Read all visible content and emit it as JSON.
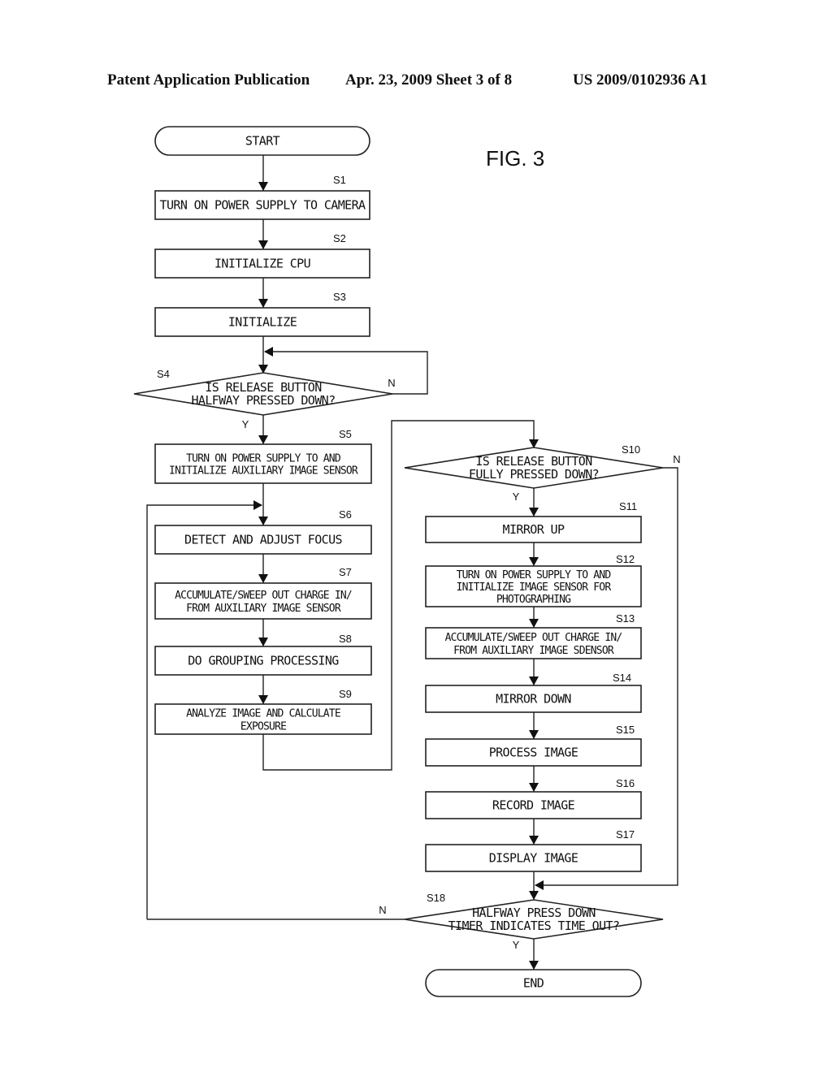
{
  "header": {
    "publication": "Patent Application Publication",
    "date_sheet": "Apr. 23, 2009  Sheet 3 of 8",
    "number": "US 2009/0102936 A1"
  },
  "figure": {
    "title": "FIG. 3"
  },
  "flowchart": {
    "start": "START",
    "end": "END",
    "steps": {
      "s1": {
        "id": "S1",
        "lines": [
          "TURN ON POWER SUPPLY TO CAMERA"
        ]
      },
      "s2": {
        "id": "S2",
        "lines": [
          "INITIALIZE CPU"
        ]
      },
      "s3": {
        "id": "S3",
        "lines": [
          "INITIALIZE"
        ]
      },
      "s4": {
        "id": "S4",
        "lines": [
          "IS RELEASE BUTTON",
          "HALFWAY PRESSED DOWN?"
        ],
        "yes": "Y",
        "no": "N"
      },
      "s5": {
        "id": "S5",
        "lines": [
          "TURN ON POWER SUPPLY TO AND",
          "INITIALIZE AUXILIARY IMAGE SENSOR"
        ]
      },
      "s6": {
        "id": "S6",
        "lines": [
          "DETECT AND ADJUST FOCUS"
        ]
      },
      "s7": {
        "id": "S7",
        "lines": [
          "ACCUMULATE/SWEEP OUT CHARGE IN/",
          "FROM AUXILIARY IMAGE SENSOR"
        ]
      },
      "s8": {
        "id": "S8",
        "lines": [
          "DO GROUPING PROCESSING"
        ]
      },
      "s9": {
        "id": "S9",
        "lines": [
          "ANALYZE IMAGE AND CALCULATE",
          "EXPOSURE"
        ]
      },
      "s10": {
        "id": "S10",
        "lines": [
          "IS RELEASE BUTTON",
          "FULLY PRESSED DOWN?"
        ],
        "yes": "Y",
        "no": "N"
      },
      "s11": {
        "id": "S11",
        "lines": [
          "MIRROR UP"
        ]
      },
      "s12": {
        "id": "S12",
        "lines": [
          "TURN ON POWER SUPPLY TO AND",
          "INITIALIZE IMAGE SENSOR FOR",
          "PHOTOGRAPHING"
        ]
      },
      "s13": {
        "id": "S13",
        "lines": [
          "ACCUMULATE/SWEEP OUT CHARGE IN/",
          "FROM AUXILIARY IMAGE SDENSOR"
        ]
      },
      "s14": {
        "id": "S14",
        "lines": [
          "MIRROR DOWN"
        ]
      },
      "s15": {
        "id": "S15",
        "lines": [
          "PROCESS IMAGE"
        ]
      },
      "s16": {
        "id": "S16",
        "lines": [
          "RECORD IMAGE"
        ]
      },
      "s17": {
        "id": "S17",
        "lines": [
          "DISPLAY IMAGE"
        ]
      },
      "s18": {
        "id": "S18",
        "lines": [
          "HALFWAY PRESS DOWN",
          "TIMER INDICATES TIME OUT?"
        ],
        "yes": "Y",
        "no": "N"
      }
    }
  }
}
